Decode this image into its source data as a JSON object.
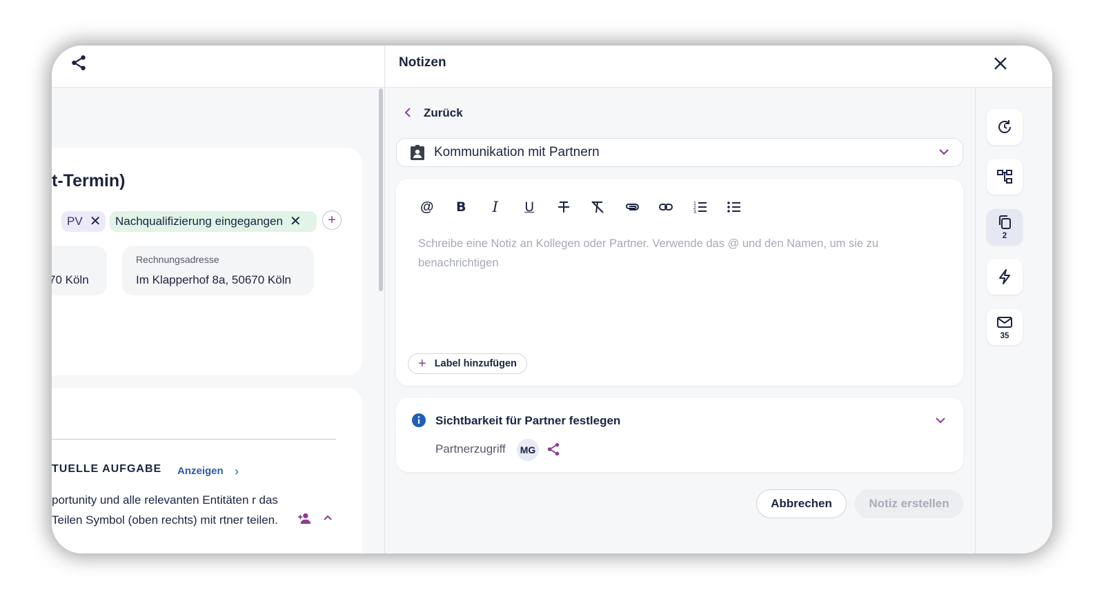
{
  "left": {
    "title": "t-Termin)",
    "chips": [
      {
        "label": "PV",
        "remove": "✕"
      },
      {
        "label": "Nachqualifizierung eingegangen",
        "remove": "✕"
      }
    ],
    "add_chip": "+",
    "address_partial": "70 Köln",
    "billing_label": "Rechnungsadresse",
    "billing_value": "Im Klapperhof 8a, 50670 Köln",
    "task_heading": "TUELLE AUFGABE",
    "show_link": "Anzeigen",
    "show_chev": "›",
    "task_text": "portunity und alle relevanten Entitäten r das Teilen Symbol (oben rechts) mit rtner teilen."
  },
  "panel": {
    "title": "Notizen",
    "back_label": "Zurück",
    "category": "Kommunikation mit Partnern",
    "placeholder": "Schreibe eine Notiz an Kollegen oder Partner. Verwende das @ und den Namen, um sie zu benachrichtigen",
    "toolbar": [
      "mention",
      "bold",
      "italic",
      "underline",
      "strikethrough",
      "clear-format",
      "attachment",
      "link",
      "numbered-list",
      "bullet-list"
    ],
    "label_button": "Label hinzufügen",
    "visibility_title": "Sichtbarkeit für Partner festlegen",
    "partner_access_label": "Partnerzugriff",
    "partner_initials": "MG",
    "cancel": "Abbrechen",
    "create": "Notiz erstellen"
  },
  "rail": {
    "items": [
      {
        "icon": "history-icon",
        "count": ""
      },
      {
        "icon": "hierarchy-icon",
        "count": ""
      },
      {
        "icon": "copies-icon",
        "count": "2"
      },
      {
        "icon": "lightning-icon",
        "count": ""
      },
      {
        "icon": "mail-icon",
        "count": "35"
      }
    ]
  },
  "colors": {
    "accent": "#8a3d94",
    "text": "#1c2340",
    "link": "#2b5cab",
    "info": "#1f5fb8",
    "tag_green": "#e2f3e7",
    "tag_purple": "#eceaf8"
  }
}
